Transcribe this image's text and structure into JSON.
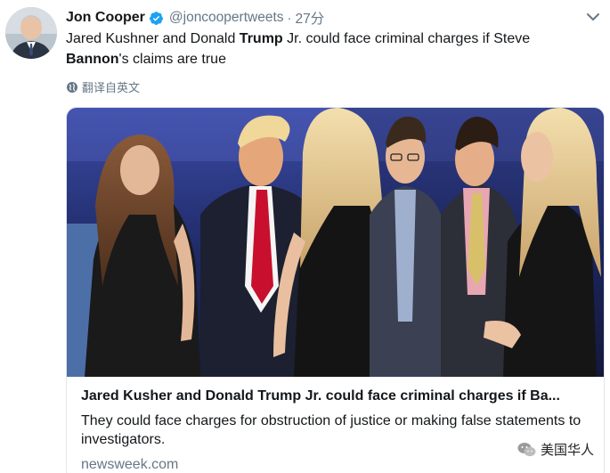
{
  "tweet": {
    "author_name": "Jon Cooper",
    "author_handle": "@joncoopertweets",
    "separator": "·",
    "time": "27分",
    "text_segments": [
      {
        "text": "Jared Kushner and Donald ",
        "bold": false
      },
      {
        "text": "Trump",
        "bold": true
      },
      {
        "text": " Jr. could face criminal charges if Steve ",
        "bold": false
      },
      {
        "text": "Bannon",
        "bold": true
      },
      {
        "text": "'s claims are true",
        "bold": false
      }
    ],
    "translate_label": "翻译自英文"
  },
  "card": {
    "title": "Jared Kusher and Donald Trump Jr. could face criminal charges if Ba...",
    "description": "They could face charges for obstruction of justice or making false statements to investigators.",
    "domain": "newsweek.com"
  },
  "watermark": {
    "text": "美国华人"
  },
  "colors": {
    "verified_blue": "#1da1f2",
    "secondary_text": "#657786",
    "primary_text": "#14171a",
    "card_border": "#e1e8ed",
    "tie_red": "#c8102e"
  },
  "icons": [
    "verified-badge-icon",
    "chevron-down-icon",
    "globe-icon",
    "wechat-icon"
  ]
}
